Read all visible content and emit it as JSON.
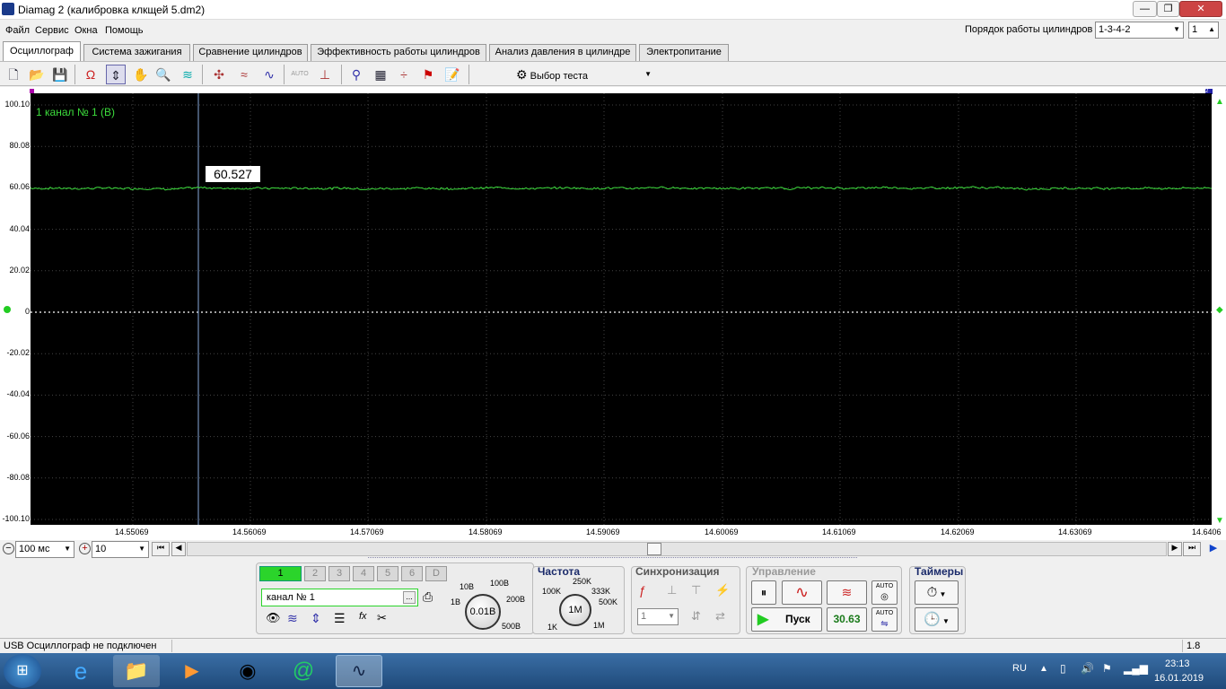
{
  "window": {
    "title": "Diamag 2 (калибровка клкщей 5.dm2)"
  },
  "menu": [
    "Файл",
    "Сервис",
    "Окна",
    "Помощь"
  ],
  "cylinder_order": {
    "label": "Порядок работы цилиндров",
    "value": "1-3-4-2",
    "count": "1"
  },
  "tabs": [
    "Осциллограф",
    "Система зажигания",
    "Сравнение цилиндров",
    "Эффективность работы цилиндров",
    "Анализ давления в цилиндре",
    "Электропитание"
  ],
  "toolbar": {
    "test_select": "Выбор теста",
    "auto": "AUTO"
  },
  "scope": {
    "channel_label": "1  канал № 1 (В)",
    "cursor_value": "60.527",
    "marker_left": "1",
    "marker_right": "2",
    "trace_color": "#3cdc3c",
    "y_ticks": [
      "100.10",
      "80.08",
      "60.06",
      "40.04",
      "20.02",
      "0",
      "-20.02",
      "-40.04",
      "-60.06",
      "-80.08",
      "-100.10"
    ],
    "x_ticks": [
      "14.55069",
      "14.56069",
      "14.57069",
      "14.58069",
      "14.59069",
      "14.60069",
      "14.61069",
      "14.62069",
      "14.63069",
      "14.6406"
    ]
  },
  "timebase": {
    "time_per_div": "100 мс",
    "zoom": "10"
  },
  "channels": {
    "buttons": [
      "1",
      "2",
      "3",
      "4",
      "5",
      "6",
      "D"
    ],
    "name": "канал № 1",
    "dots": "..."
  },
  "amplitude": {
    "value": "0.01В",
    "labels": [
      "10В",
      "100В",
      "1В",
      "200В",
      "500В"
    ]
  },
  "frequency": {
    "title": "Частота",
    "value": "1М",
    "labels": [
      "250K",
      "100K",
      "333K",
      "500K",
      "1K",
      "1M"
    ]
  },
  "sync": {
    "title": "Синхронизация",
    "channel": "1"
  },
  "control": {
    "title": "Управление",
    "start": "Пуск",
    "value": "30.63",
    "auto1": "AUTO",
    "auto2": "AUTO"
  },
  "timers": {
    "title": "Таймеры"
  },
  "status": {
    "text": "USB Осциллограф не подключен",
    "version": "1.8"
  },
  "taskbar": {
    "lang": "RU",
    "time": "23:13",
    "date": "16.01.2019"
  }
}
